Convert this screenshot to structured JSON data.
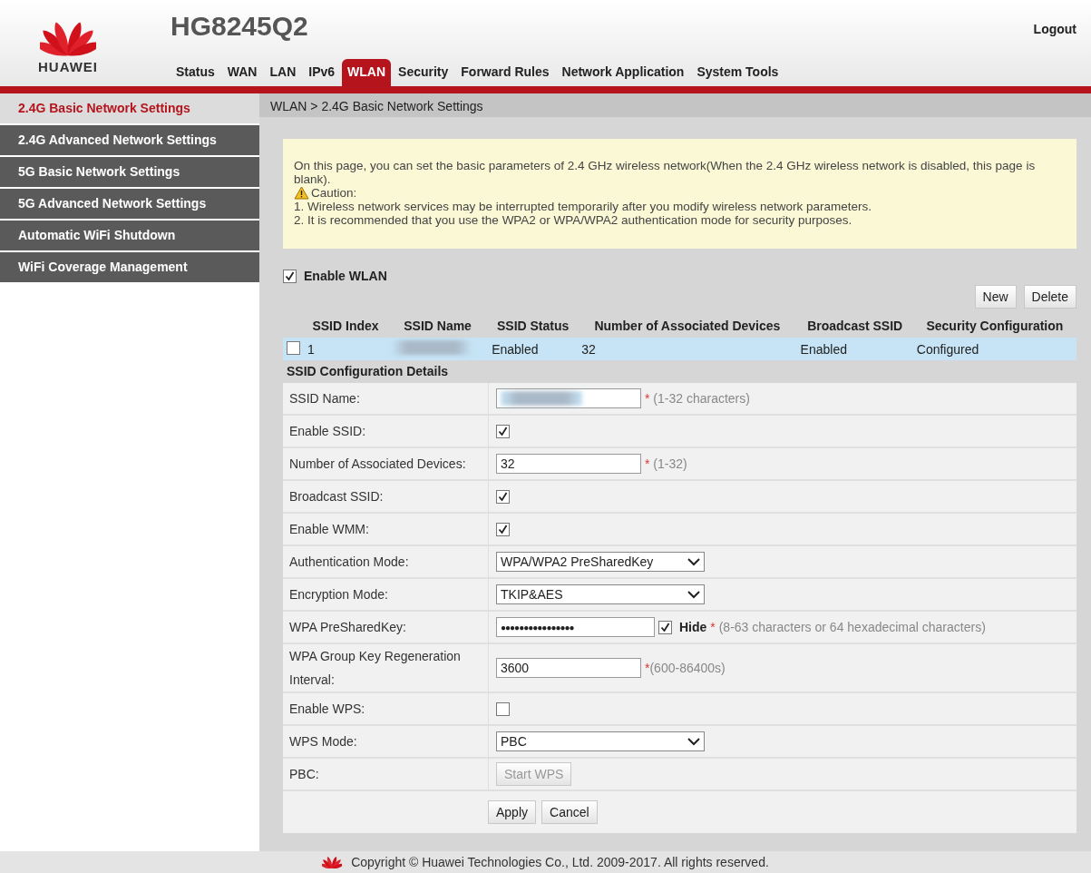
{
  "header": {
    "model": "HG8245Q2",
    "brand": "HUAWEI",
    "logout": "Logout"
  },
  "nav": [
    {
      "label": "Status",
      "selected": false
    },
    {
      "label": "WAN",
      "selected": false
    },
    {
      "label": "LAN",
      "selected": false
    },
    {
      "label": "IPv6",
      "selected": false
    },
    {
      "label": "WLAN",
      "selected": true
    },
    {
      "label": "Security",
      "selected": false
    },
    {
      "label": "Forward Rules",
      "selected": false
    },
    {
      "label": "Network Application",
      "selected": false
    },
    {
      "label": "System Tools",
      "selected": false
    }
  ],
  "sidebar": {
    "items": [
      {
        "label": "2.4G Basic Network Settings",
        "selected": true
      },
      {
        "label": "2.4G Advanced Network Settings",
        "selected": false
      },
      {
        "label": "5G Basic Network Settings",
        "selected": false
      },
      {
        "label": "5G Advanced Network Settings",
        "selected": false
      },
      {
        "label": "Automatic WiFi Shutdown",
        "selected": false
      },
      {
        "label": "WiFi Coverage Management",
        "selected": false
      }
    ]
  },
  "breadcrumb": "WLAN > 2.4G Basic Network Settings",
  "notice": {
    "text": "On this page, you can set the basic parameters of 2.4 GHz wireless network(When the 2.4 GHz wireless network is disabled, this page is blank).",
    "caution": "Caution:",
    "items": [
      "1. Wireless network services may be interrupted temporarily after you modify wireless network parameters.",
      "2. It is recommended that you use the WPA2 or WPA/WPA2 authentication mode for security purposes."
    ]
  },
  "enable_wlan": {
    "label": "Enable WLAN",
    "checked": true
  },
  "table_buttons": [
    "New",
    "Delete"
  ],
  "table": {
    "columns": [
      "SSID Index",
      "SSID Name",
      "SSID Status",
      "Number of Associated Devices",
      "Broadcast SSID",
      "Security Configuration"
    ],
    "rows": [
      {
        "selected": true,
        "checked": false,
        "cells": [
          {
            "text": "1"
          },
          {
            "redacted": true
          },
          {
            "text": "Enabled"
          },
          {
            "text": "32"
          },
          {
            "text": "Enabled"
          },
          {
            "text": "Configured"
          }
        ]
      }
    ]
  },
  "details": {
    "title": "SSID Configuration Details",
    "rows": [
      {
        "kind": "input",
        "label": "SSID Name:",
        "redacted": true,
        "mark": "*",
        "hint": " (1-32 characters)"
      },
      {
        "kind": "checkbox",
        "label": "Enable SSID:",
        "checked": true
      },
      {
        "kind": "input",
        "label": "Number of Associated Devices:",
        "value": "32",
        "mark": "*",
        "hint": " (1-32)"
      },
      {
        "kind": "checkbox",
        "label": "Broadcast SSID:",
        "checked": true
      },
      {
        "kind": "checkbox",
        "label": "Enable WMM:",
        "checked": true
      },
      {
        "kind": "select",
        "label": "Authentication Mode:",
        "value": "WPA/WPA2 PreSharedKey"
      },
      {
        "kind": "select",
        "label": "Encryption Mode:",
        "value": "TKIP&AES"
      },
      {
        "kind": "password",
        "label": "WPA PreSharedKey:",
        "value": "●●●●●●●●●●●●●●●●",
        "hide_label": "Hide",
        "hide_checked": true,
        "mark": "*",
        "hint": " (8-63 characters or 64 hexadecimal characters)"
      },
      {
        "kind": "input",
        "label": "WPA Group Key Regeneration Interval:",
        "value": "3600",
        "mark": "*",
        "hint": "(600-86400s)"
      },
      {
        "kind": "checkbox",
        "label": "Enable WPS:",
        "checked": false
      },
      {
        "kind": "select",
        "label": "WPS Mode:",
        "value": "PBC"
      },
      {
        "kind": "button",
        "label": "PBC:",
        "button": "Start WPS",
        "disabled": true
      }
    ],
    "actions": [
      "Apply",
      "Cancel"
    ]
  },
  "footer": "Copyright © Huawei Technologies Co., Ltd. 2009-2017. All rights reserved."
}
